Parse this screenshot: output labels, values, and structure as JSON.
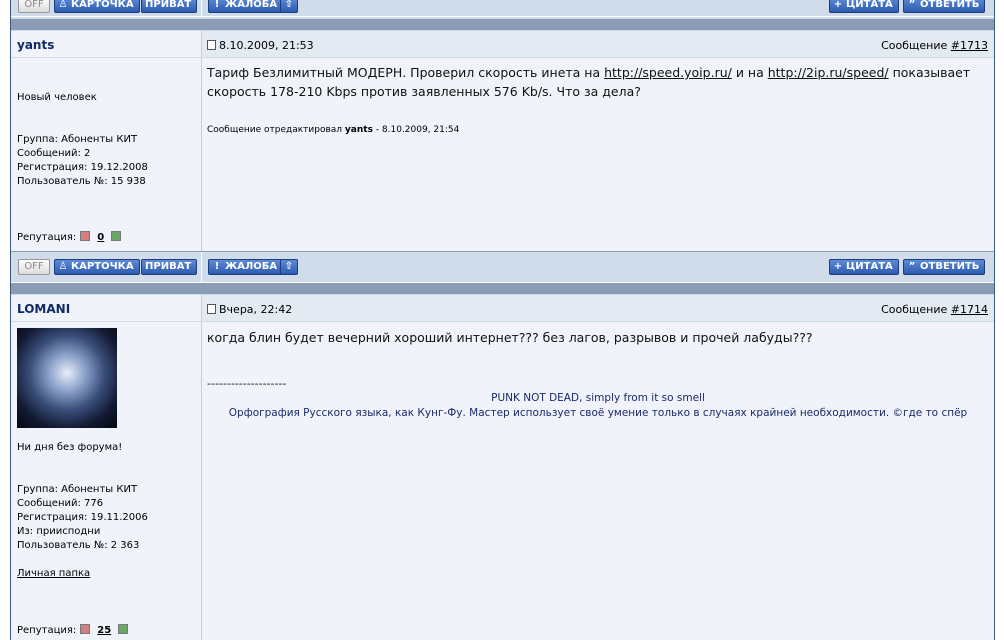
{
  "buttons": {
    "off": "OFF",
    "card": "КАРТОЧКА",
    "privat": "ПРИВАТ",
    "complaint": "ЖАЛОБА",
    "quote": "ЦИТАТА",
    "reply": "ОТВЕТИТЬ"
  },
  "posts": [
    {
      "username": "yants",
      "date": "8.10.2009, 21:53",
      "post_label": "Сообщение",
      "post_num": "#1713",
      "title": "Новый человек",
      "group": "Группа: Абоненты КИТ",
      "messages": "Сообщений: 2",
      "registration": "Регистрация: 19.12.2008",
      "user_no": "Пользователь №: 15 938",
      "rep_label": "Репутация:",
      "rep_value": "0",
      "body_parts": {
        "t1": "Тариф Безлимитный МОДЕРН. Проверил скорость инета на ",
        "link1": "http://speed.yoip.ru/",
        "t2": " и на ",
        "link2": "http://2ip.ru/speed/",
        "t3": " показывает",
        "line2": "скорость 178-210 Kbps против заявленных 576 Kb/s. Что за дела?"
      },
      "edit_prefix": "Сообщение отредактировал ",
      "edit_user": "yants",
      "edit_suffix": " - 8.10.2009, 21:54"
    },
    {
      "username": "LOMANI",
      "date": "Вчера, 22:42",
      "post_label": "Сообщение",
      "post_num": "#1714",
      "title": "Ни дня без форума!",
      "group": "Группа: Абоненты КИТ",
      "messages": "Сообщений: 776",
      "registration": "Регистрация: 19.11.2006",
      "from": "Из: приисподни",
      "user_no": "Пользователь №: 2 363",
      "personal_folder": "Личная папка",
      "rep_label": "Репутация:",
      "rep_value": "25",
      "body": "когда блин будет вечерний хороший интернет??? без лагов, разрывов и прочей лабуды???",
      "sig_separator": "--------------------",
      "sig_line1": "PUNK NOT DEAD, simply from it so smell",
      "sig_line2": "Орфография Русского языка, как Кунг-Фу. Мастер использует своё умение только в случаях крайней необходимости. ©где то спёр"
    }
  ],
  "icons": {
    "card_icon": "person-icon",
    "complaint_icon": "exclamation-icon",
    "up_icon": "arrow-up-icon",
    "quote_icon": "plus-icon",
    "reply_icon": "quote-marks-icon"
  },
  "colors": {
    "frame_bg": "#d1dceb",
    "dark_bar": "#8b9cb6",
    "button": "#2d5bb0",
    "username": "#0f2a66"
  }
}
